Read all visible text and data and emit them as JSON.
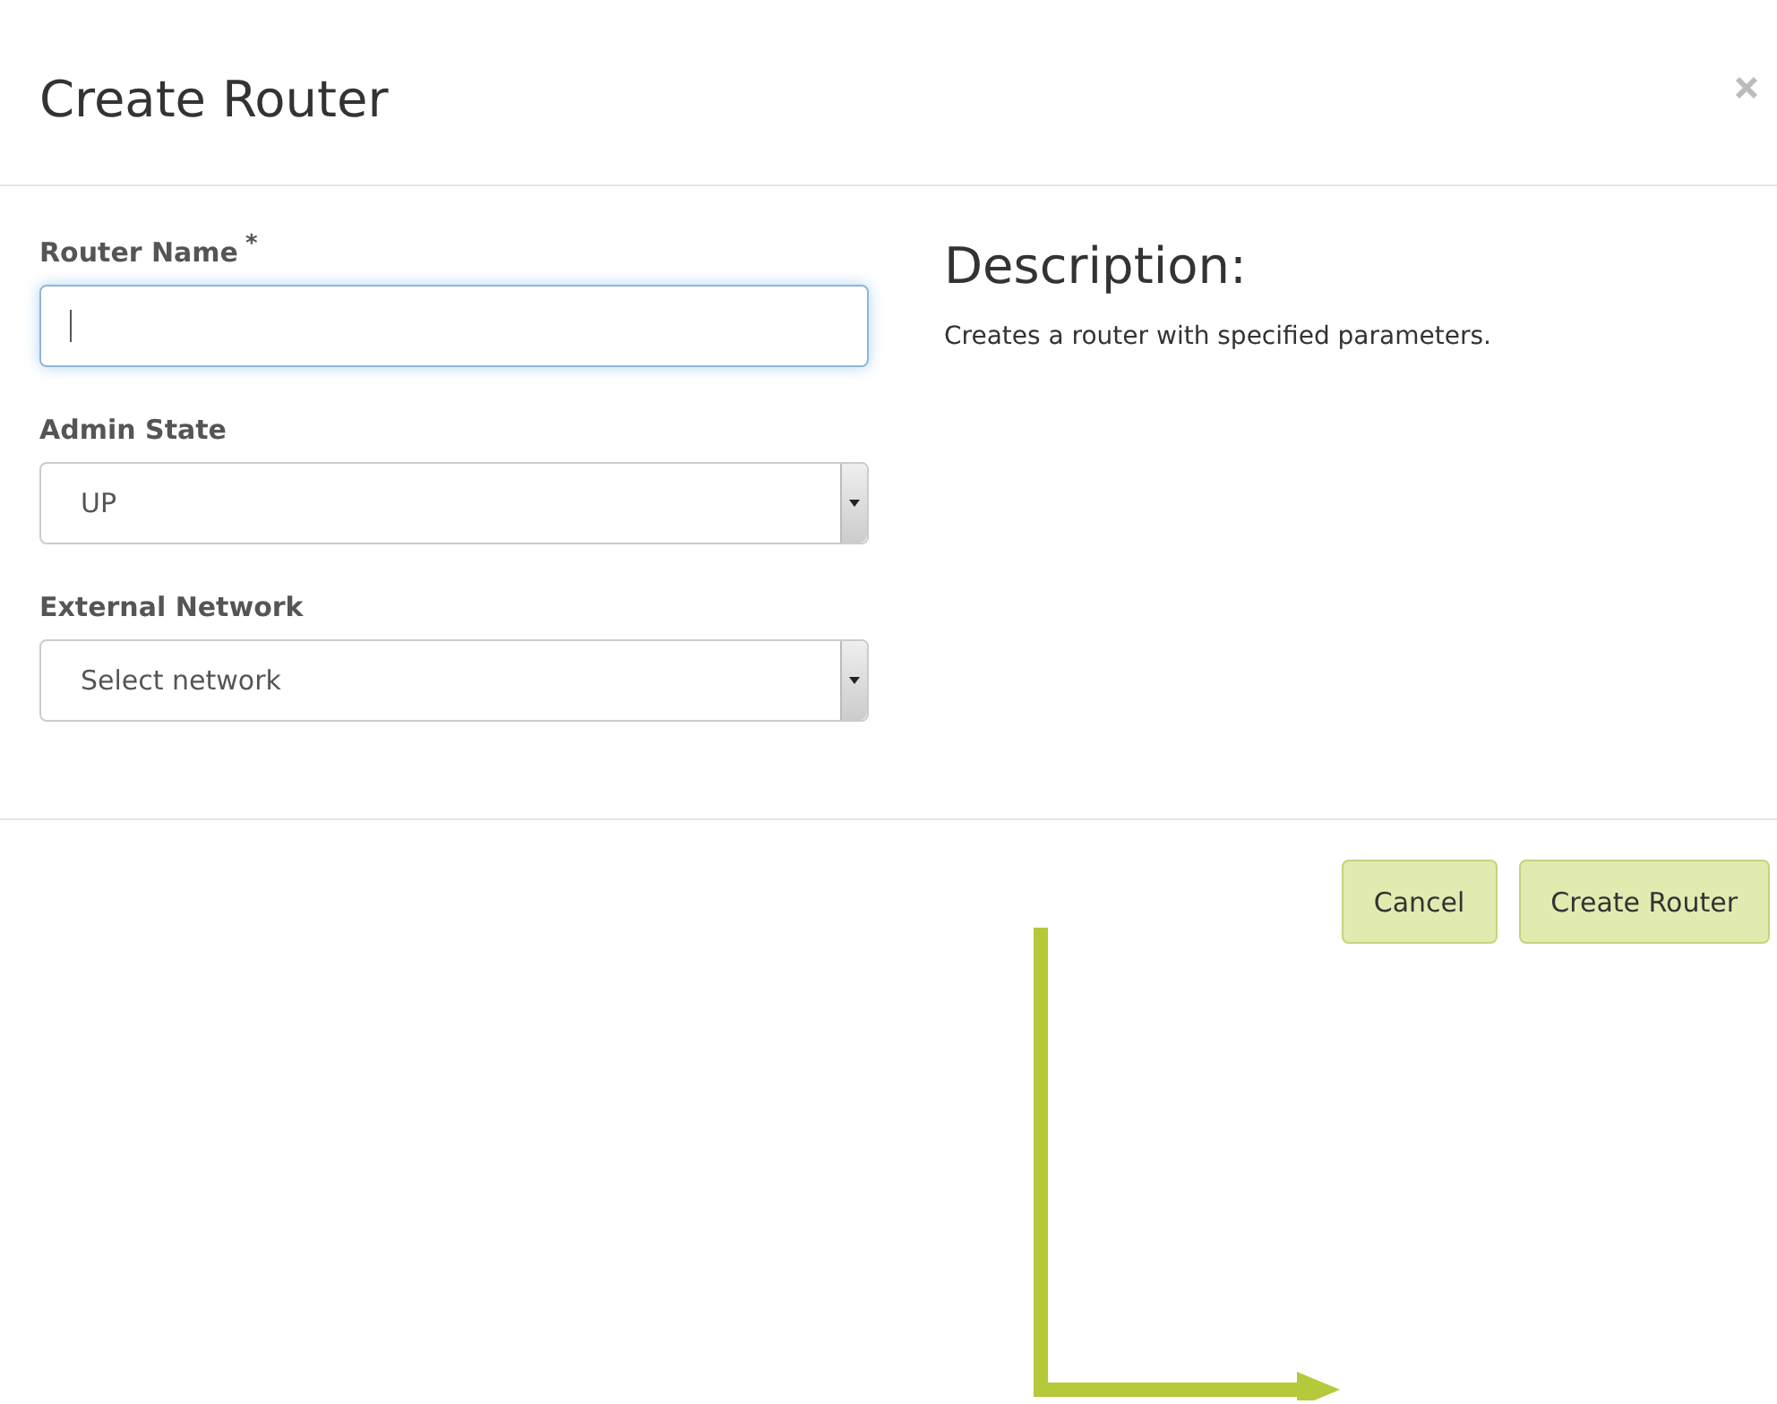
{
  "dialog": {
    "title": "Create Router",
    "fields": [
      {
        "kind": "text",
        "label": "Router Name",
        "required_mark": "*",
        "focused": true
      },
      {
        "kind": "select",
        "label": "Admin State",
        "value": "UP",
        "focused": false
      },
      {
        "kind": "select",
        "label": "External Network",
        "value": "Select network",
        "focused": false
      }
    ],
    "description": {
      "heading": "Description:",
      "text": "Creates a router with specified parameters."
    },
    "buttons": [
      "Cancel",
      "Create Router"
    ]
  }
}
